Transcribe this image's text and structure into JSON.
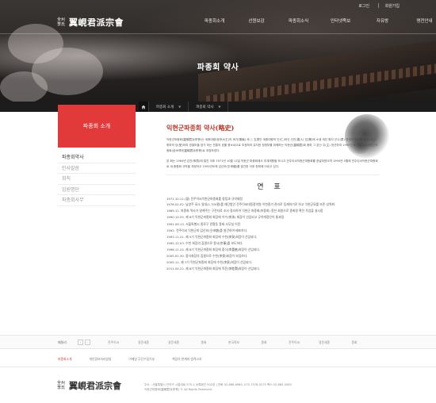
{
  "utility": {
    "login": "로그인",
    "join": "회원가입"
  },
  "logo": {
    "seal": "全州李氏",
    "wordmark": "翼峴君派宗會"
  },
  "gnb": [
    "파종회소개",
    "선원보감",
    "파종회소식",
    "인터넷족보",
    "자유방",
    "명전안내"
  ],
  "hero": {
    "title": "파종회 약사"
  },
  "breadcrumb": [
    "파종회 소개",
    "파종회 약사"
  ],
  "sidebar": {
    "title": "파종회 소개",
    "items": [
      "파종회약사",
      "인사말씀",
      "회칙",
      "임원명단",
      "파종회사무"
    ]
  },
  "content": {
    "title": "익현군파종회 약사(略史)",
    "para1": "익현군파종회(翼峴君派宗會)는 세종대왕(世宗大王)의 제기(第幾) 제 ○ 五男인 세종대왕의 인(仁)하신 선인(善人) 업(業)에 소생 계인 왕자 군수(君)·쟁쟁회 뿌리를 실세시하고 휘하의 당(堂)하여 영결모을 참가 하는 전통의 호를 충소씨으로 조정하여 유지한 정명부를 위해하는 익현군(翼峴君)회 종파 그 본산 주(主) 영선하여 1990년 회 전주이씨익현군파종회(全州李氏翼峴君派宗會)로 개칭하였다.",
    "para2": "본 회는 1964년 갑진(甲辰)에 발진 이후 1971년 10월 11일 익현군 파종회에서 추계제향을 모시고 전주이씨익현군파종회를 창설하였으며 1990년 5월에 전주이씨익현군파종회로 새 종합회 규약을 개정하고 1992년도에 임신보(壬申譜)를 발간한 이후 현재에 이르고 있다."
  },
  "yearly": {
    "title": "연 표",
    "rows": [
      "1971.10.11.(월) 전주이씨익현군파종회를 창립과 규약제정",
      "1978.02.02. 남양주 묘소 일대(1,700평)를 재단법인 전주이씨대동종약원 이천종가 관리로 등재하기로 하고 익현군묘를 보존 성역화",
      "1989.11. 파종회 역사가 말해주는 구전자료 조사 정리하여 익현군 파종회(파종회) 종친 회원으로 종회원 확인 작업을 실시함",
      "1990.10.25. 제 6기 익현군파종회 회장에 이수(李洙) 회장이 선임되고 규약개정안이 통과됨",
      "1991.09.13. 서울특별시 종로구 관철동 종회 사무실 이전",
      "1992. 전주이씨 익현군파 임신보(壬申譜)를 발간하여 배포하다.",
      "1993.11.21. 제 5기 익현군파종회 회장에 수천(李泉)회장이 선임되다.",
      "1995.12.03. 수천 회장의 집필으로 종사(宗事)를 보도하다.",
      "1996.11.24. 제 6기 익현군파종회 회장에 중식(李重植)회장이 선임되다.",
      "2005.01.30. 중식회장의 집필으로 수천(李泉)회장이 보임하다.",
      "2005.11. 제 7기 익현군파종회 회장에 수천(李泉)회장이 선임되다.",
      "2011.04.22. 제 8기 익현군파종회 회장에 목윤(李睦潤)회장이 선임되다."
    ]
  },
  "partners": {
    "label": "패밀리",
    "prev": "‹",
    "next": "›",
    "logos": [
      "전주이씨",
      "경운세종",
      "경운세종",
      "종회",
      "한국족보",
      "종회",
      "전주이씨",
      "경운세종",
      "종회"
    ]
  },
  "footer": {
    "links": [
      "파종회소개",
      "개인정보처리방침",
      "이메일 무단수집거부",
      "책임의 한계와 법적고지"
    ],
    "address": "주소 : 서울특별시 관악구 시흥대로 575-1 상록회관 502호 | 전화 02-886-6980, 070-7576-0275 팩스 02-885-0083",
    "copyright": "익현군파종회(翼峴君派宗會) © All Rights Reserved."
  }
}
